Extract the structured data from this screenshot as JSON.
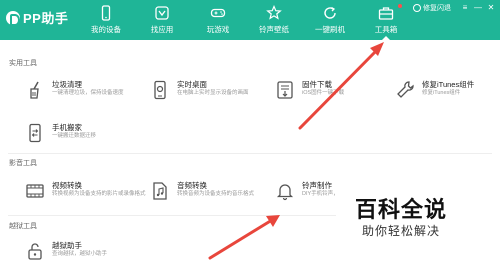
{
  "app": {
    "name": "PP助手"
  },
  "nav": [
    {
      "label": "我的设备",
      "icon": "phone-icon"
    },
    {
      "label": "找应用",
      "icon": "app-store-icon"
    },
    {
      "label": "玩游戏",
      "icon": "gamepad-icon"
    },
    {
      "label": "铃声壁纸",
      "icon": "ringtone-wallpaper-icon"
    },
    {
      "label": "一键刷机",
      "icon": "refresh-icon"
    },
    {
      "label": "工具箱",
      "icon": "toolbox-icon",
      "active": true
    }
  ],
  "topright": {
    "repair": "修复闪退",
    "menu": "≡",
    "minimize": "—",
    "close": "✕"
  },
  "sections": {
    "practical": "实用工具",
    "media": "影音工具",
    "jailbreak": "越狱工具"
  },
  "tools": {
    "junk_cleanup": {
      "name": "垃圾清理",
      "desc": "一键清理垃圾，保持设备速度",
      "icon": "broom-icon"
    },
    "live_desktop": {
      "name": "实时桌面",
      "desc": "在电脑上实时显示设备的画面",
      "icon": "screen-icon"
    },
    "firmware_download": {
      "name": "固件下载",
      "desc": "iOS固件一键下载",
      "icon": "firmware-icon"
    },
    "repair_itunes": {
      "name": "修复iTunes组件",
      "desc": "修复iTunes组件",
      "icon": "wrench-icon"
    },
    "phone_mover": {
      "name": "手机搬家",
      "desc": "一键搬迁数据迁移",
      "icon": "phone-transfer-icon"
    },
    "video_convert": {
      "name": "视频转换",
      "desc": "转换视频为设备支持的影片或录像格式",
      "icon": "film-icon"
    },
    "audio_convert": {
      "name": "音频转换",
      "desc": "转换音频为设备支持的音乐格式",
      "icon": "music-file-icon"
    },
    "ringtone_maker": {
      "name": "铃声制作",
      "desc": "DIY手机铃声，一",
      "icon": "bell-icon"
    },
    "jailbreak_helper": {
      "name": "越狱助手",
      "desc": "查询越狱，越狱小助手",
      "icon": "unlock-icon"
    }
  },
  "watermark": {
    "title": "百科全说",
    "subtitle": "助你轻松解决"
  },
  "colors": {
    "brand": "#1fb597",
    "arrow": "#e8463c",
    "icon": "#555555"
  }
}
